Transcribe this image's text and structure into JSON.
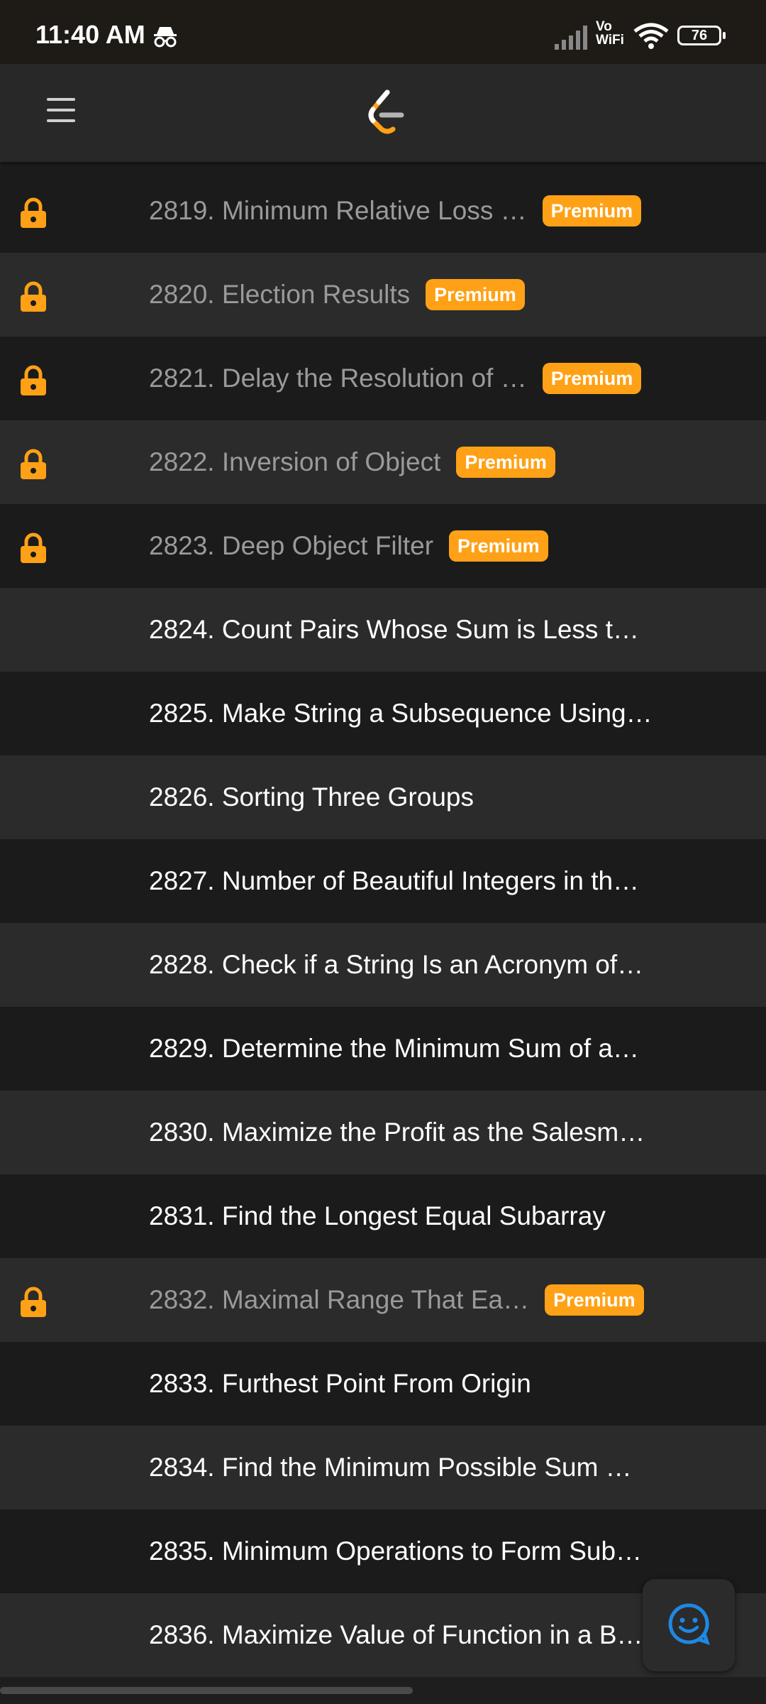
{
  "status_bar": {
    "time": "11:40 AM",
    "icons": [
      "incognito-icon",
      "signal-icon",
      "vowifi-icon",
      "wifi-icon"
    ],
    "vowifi": "Vo\nWiFi",
    "battery": "76"
  },
  "app_bar": {
    "icons": [
      "menu-icon",
      "leetcode-logo-icon"
    ]
  },
  "colors": {
    "premium": "#ffa116",
    "lock": "#ffa116",
    "chat": "#1e88e5"
  },
  "problems": [
    {
      "title": "2819. Minimum Relative Loss …",
      "locked": true,
      "badge": "Premium"
    },
    {
      "title": "2820. Election Results",
      "locked": true,
      "badge": "Premium"
    },
    {
      "title": "2821. Delay the Resolution of …",
      "locked": true,
      "badge": "Premium"
    },
    {
      "title": "2822. Inversion of Object",
      "locked": true,
      "badge": "Premium"
    },
    {
      "title": "2823. Deep Object Filter",
      "locked": true,
      "badge": "Premium"
    },
    {
      "title": "2824. Count Pairs Whose Sum is Less t…",
      "locked": false
    },
    {
      "title": "2825. Make String a Subsequence Using…",
      "locked": false
    },
    {
      "title": "2826. Sorting Three Groups",
      "locked": false
    },
    {
      "title": "2827. Number of Beautiful Integers in th…",
      "locked": false
    },
    {
      "title": "2828. Check if a String Is an Acronym of…",
      "locked": false
    },
    {
      "title": "2829. Determine the Minimum Sum of a…",
      "locked": false
    },
    {
      "title": "2830. Maximize the Profit as the Salesm…",
      "locked": false
    },
    {
      "title": "2831. Find the Longest Equal Subarray",
      "locked": false
    },
    {
      "title": "2832. Maximal Range That Ea…",
      "locked": true,
      "badge": "Premium"
    },
    {
      "title": "2833. Furthest Point From Origin",
      "locked": false
    },
    {
      "title": "2834. Find the Minimum Possible Sum …",
      "locked": false
    },
    {
      "title": "2835. Minimum Operations to Form Sub…",
      "locked": false
    },
    {
      "title": "2836. Maximize Value of Function in a B…",
      "locked": false
    }
  ],
  "fab": {
    "icon": "chat-smile-icon"
  }
}
